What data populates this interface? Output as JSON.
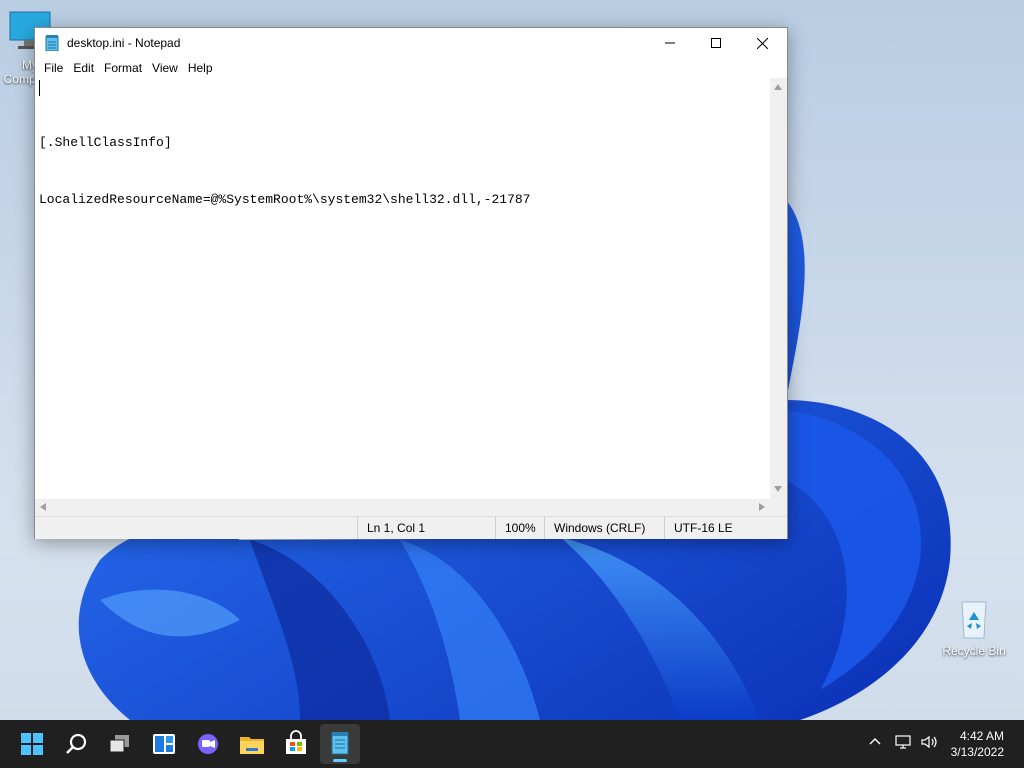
{
  "window": {
    "title": "desktop.ini - Notepad",
    "controls": {
      "minimize": "minimize",
      "maximize": "maximize",
      "close": "close"
    }
  },
  "menu": [
    "File",
    "Edit",
    "Format",
    "View",
    "Help"
  ],
  "editor": {
    "lines": [
      "",
      "[.ShellClassInfo]",
      "LocalizedResourceName=@%SystemRoot%\\system32\\shell32.dll,-21787"
    ]
  },
  "status": {
    "position": "Ln 1, Col 1",
    "zoom": "100%",
    "line_ending": "Windows (CRLF)",
    "encoding": "UTF-16 LE"
  },
  "desktop": {
    "my_computer_label": "My Computer",
    "recycle_bin_label": "Recycle Bin"
  },
  "taskbar": {
    "icons": [
      "start-icon",
      "search-icon",
      "task-view-icon",
      "widgets-icon",
      "chat-icon",
      "file-explorer-icon",
      "store-icon",
      "notepad-icon"
    ],
    "time": "4:42 AM",
    "date": "3/13/2022"
  },
  "colors": {
    "accent": "#60cdff",
    "taskbar": "#202020",
    "bloom": "#1a4fd8"
  }
}
